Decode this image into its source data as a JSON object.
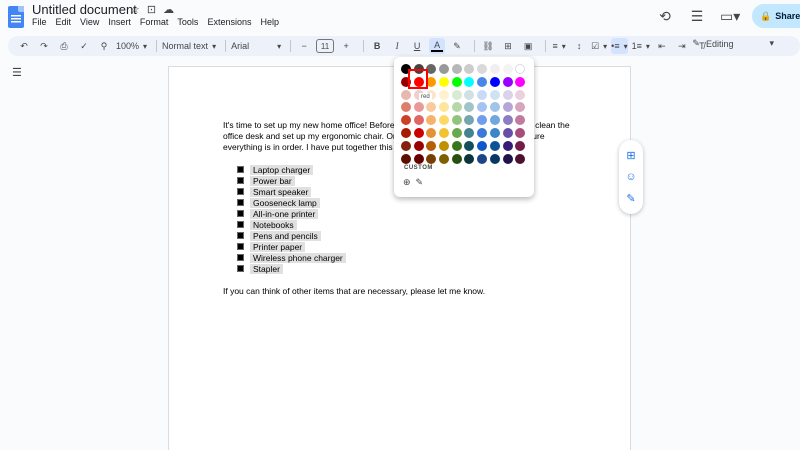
{
  "header": {
    "title": "Untitled document",
    "title_icons": [
      "star-icon",
      "folder-icon",
      "cloud-icon"
    ],
    "menu": [
      "File",
      "Edit",
      "View",
      "Insert",
      "Format",
      "Tools",
      "Extensions",
      "Help"
    ],
    "share_label": "Share"
  },
  "toolbar": {
    "zoom": "100%",
    "style": "Normal text",
    "font": "Arial",
    "font_size": "11",
    "bold": "B",
    "italic": "I",
    "underline": "U",
    "text_color_glyph": "A",
    "mode": "Editing"
  },
  "document": {
    "para1": "It's time to set up my new home office! Before getting everything set up, I'll need to clean the office desk and set up my ergonomic chair. Once that's done, I'll be able to make sure everything is in order. I have put together this list of items:",
    "list": [
      "Laptop charger",
      "Power bar",
      "Smart speaker",
      "Gooseneck lamp",
      "All-in-one printer",
      "Notebooks",
      "Pens and pencils",
      "Printer paper",
      "Wireless phone charger",
      "Stapler"
    ],
    "para2": "If you can think of other items that are necessary, please let me know."
  },
  "color_picker": {
    "tooltip": "red",
    "custom_label": "CUSTOM",
    "rows": [
      [
        "#000000",
        "#434343",
        "#666666",
        "#999999",
        "#b7b7b7",
        "#cccccc",
        "#d9d9d9",
        "#efefef",
        "#f3f3f3",
        "#ffffff"
      ],
      [
        "#980000",
        "#ff0000",
        "#ff9900",
        "#ffff00",
        "#00ff00",
        "#00ffff",
        "#4a86e8",
        "#0000ff",
        "#9900ff",
        "#ff00ff"
      ],
      [
        "#e6b8af",
        "#f4cccc",
        "#fce5cd",
        "#fff2cc",
        "#d9ead3",
        "#d0e0e3",
        "#c9daf8",
        "#cfe2f3",
        "#d9d2e9",
        "#ead1dc"
      ],
      [
        "#dd7e6b",
        "#ea9999",
        "#f9cb9c",
        "#ffe599",
        "#b6d7a8",
        "#a2c4c9",
        "#a4c2f4",
        "#9fc5e8",
        "#b4a7d6",
        "#d5a6bd"
      ],
      [
        "#cc4125",
        "#e06666",
        "#f6b26b",
        "#ffd966",
        "#93c47d",
        "#76a5af",
        "#6d9eeb",
        "#6fa8dc",
        "#8e7cc3",
        "#c27ba0"
      ],
      [
        "#a61c00",
        "#cc0000",
        "#e69138",
        "#f1c232",
        "#6aa84f",
        "#45818e",
        "#3c78d8",
        "#3d85c6",
        "#674ea7",
        "#a64d79"
      ],
      [
        "#85200c",
        "#990000",
        "#b45f06",
        "#bf9000",
        "#38761d",
        "#134f5c",
        "#1155cc",
        "#0b5394",
        "#351c75",
        "#741b47"
      ],
      [
        "#5b0f00",
        "#660000",
        "#783f04",
        "#7f6000",
        "#274e13",
        "#0c343d",
        "#1c4587",
        "#073763",
        "#20124d",
        "#4c1130"
      ]
    ]
  }
}
